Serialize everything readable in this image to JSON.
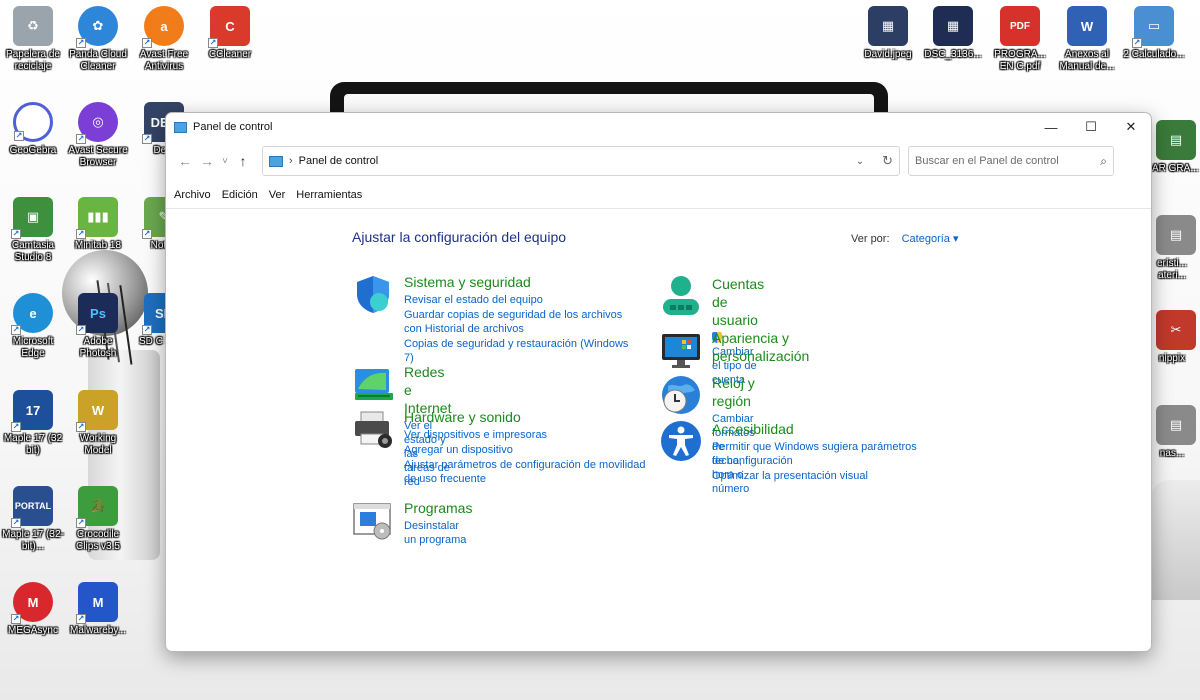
{
  "desktop": {
    "icons_left": [
      {
        "label": "Papelera de reciclaje",
        "icon": "recycle-bin-icon",
        "color": "#9aa4ad"
      },
      {
        "label": "Panda Cloud Cleaner",
        "icon": "panda-cloud-cleaner-icon",
        "color": "#2e86d8"
      },
      {
        "label": "Avast Free Antivirus",
        "icon": "avast-antivirus-icon",
        "color": "#f07d1a"
      },
      {
        "label": "CCleaner",
        "icon": "ccleaner-icon",
        "color": "#d93a2b"
      },
      {
        "label": "GeoGebra",
        "icon": "geogebra-icon",
        "color": "#4f5fd9"
      },
      {
        "label": "Avast Secure Browser",
        "icon": "avast-secure-browser-icon",
        "color": "#7b3fd6"
      },
      {
        "label": "Dev-",
        "icon": "dev-cpp-icon",
        "color": "#334466"
      },
      {
        "label": "Camtasia Studio 8",
        "icon": "camtasia-icon",
        "color": "#3e8f3e"
      },
      {
        "label": "Minitab 18",
        "icon": "minitab-icon",
        "color": "#6ab541"
      },
      {
        "label": "Notep",
        "icon": "notepad-icon",
        "color": "#6aa84f"
      },
      {
        "label": "Microsoft Edge",
        "icon": "edge-icon",
        "color": "#1f8fd6"
      },
      {
        "label": "Adobe Photosh",
        "icon": "photoshop-icon",
        "color": "#1b2c58"
      },
      {
        "label": "SD C Form",
        "icon": "sd-card-icon",
        "color": "#1e6fbf"
      },
      {
        "label": "Maple 17 (32 bit)",
        "icon": "maple-icon",
        "color": "#c0392b"
      },
      {
        "label": "Working Model",
        "icon": "working-model-icon",
        "color": "#c9a227"
      },
      {
        "label": "Maple 17 (32-bit)...",
        "icon": "maple-portal-icon",
        "color": "#2a4f8f"
      },
      {
        "label": "Crocodile Clips v3.5",
        "icon": "crocodile-clips-icon",
        "color": "#3d9c3d"
      },
      {
        "label": "MEGAsync",
        "icon": "megasync-icon",
        "color": "#d9272e"
      },
      {
        "label": "Malwareby...",
        "icon": "malwarebytes-icon",
        "color": "#2456c9"
      }
    ],
    "icons_right": [
      {
        "label": "David.jpeg",
        "icon": "image-file-icon",
        "color": "#2c3e63"
      },
      {
        "label": "DSC_3136...",
        "icon": "photo-file-icon",
        "color": "#1f2d55"
      },
      {
        "label": "PROGRA... EN C.pdf",
        "icon": "pdf-file-icon",
        "color": "#d6322b"
      },
      {
        "label": "Anexos al Manual de...",
        "icon": "word-document-icon",
        "color": "#2f62b5"
      },
      {
        "label": "2 Calculado...",
        "icon": "calculator-app-icon",
        "color": "#4a8fd1"
      },
      {
        "label": "SAR GRA...",
        "icon": "sar-file-icon",
        "color": "#3a7a3a"
      },
      {
        "label": "erísti... ateri...",
        "icon": "document-file-icon",
        "color": "#8a8a8a"
      },
      {
        "label": "nippix",
        "icon": "snippix-icon",
        "color": "#c0392b"
      },
      {
        "label": "nas...",
        "icon": "text-file-icon",
        "color": "#8a8a8a"
      }
    ]
  },
  "window": {
    "title": "Panel de control",
    "minimize": "—",
    "maximize": "☐",
    "close": "✕"
  },
  "navigation": {
    "back": "←",
    "forward": "→",
    "recent": "˅",
    "up": "↑",
    "breadcrumb_separator": "›",
    "path": "Panel de control",
    "dropdown": "⌄",
    "refresh": "↻"
  },
  "search": {
    "placeholder": "Buscar en el Panel de control",
    "value": ""
  },
  "menu": [
    "Archivo",
    "Edición",
    "Ver",
    "Herramientas"
  ],
  "main": {
    "heading": "Ajustar la configuración del equipo",
    "view_by_label": "Ver por:",
    "view_by_value": "Categoría ▾",
    "categories_left": [
      {
        "title": "Sistema y seguridad",
        "links": [
          "Revisar el estado del equipo",
          "Guardar copias de seguridad de los archivos con Historial de archivos",
          "Copias de seguridad y restauración (Windows 7)"
        ]
      },
      {
        "title": "Redes e Internet",
        "links": [
          "Ver el estado y las tareas de red"
        ]
      },
      {
        "title": "Hardware y sonido",
        "links": [
          "Ver dispositivos e impresoras",
          "Agregar un dispositivo",
          "Ajustar parámetros de configuración de movilidad de uso frecuente"
        ]
      },
      {
        "title": "Programas",
        "links": [
          "Desinstalar un programa"
        ]
      }
    ],
    "categories_right": [
      {
        "title": "Cuentas de usuario",
        "links": [
          "Cambiar el tipo de cuenta"
        ]
      },
      {
        "title": "Apariencia y personalización",
        "links": []
      },
      {
        "title": "Reloj y región",
        "links": [
          "Cambiar formatos de fecha, hora o número"
        ]
      },
      {
        "title": "Accesibilidad",
        "links": [
          "Permitir que Windows sugiera parámetros de configuración",
          "Optimizar la presentación visual"
        ]
      }
    ]
  },
  "colors": {
    "category_title": "#1c8a1c",
    "link": "#0b64c9",
    "heading": "#1e3287"
  }
}
